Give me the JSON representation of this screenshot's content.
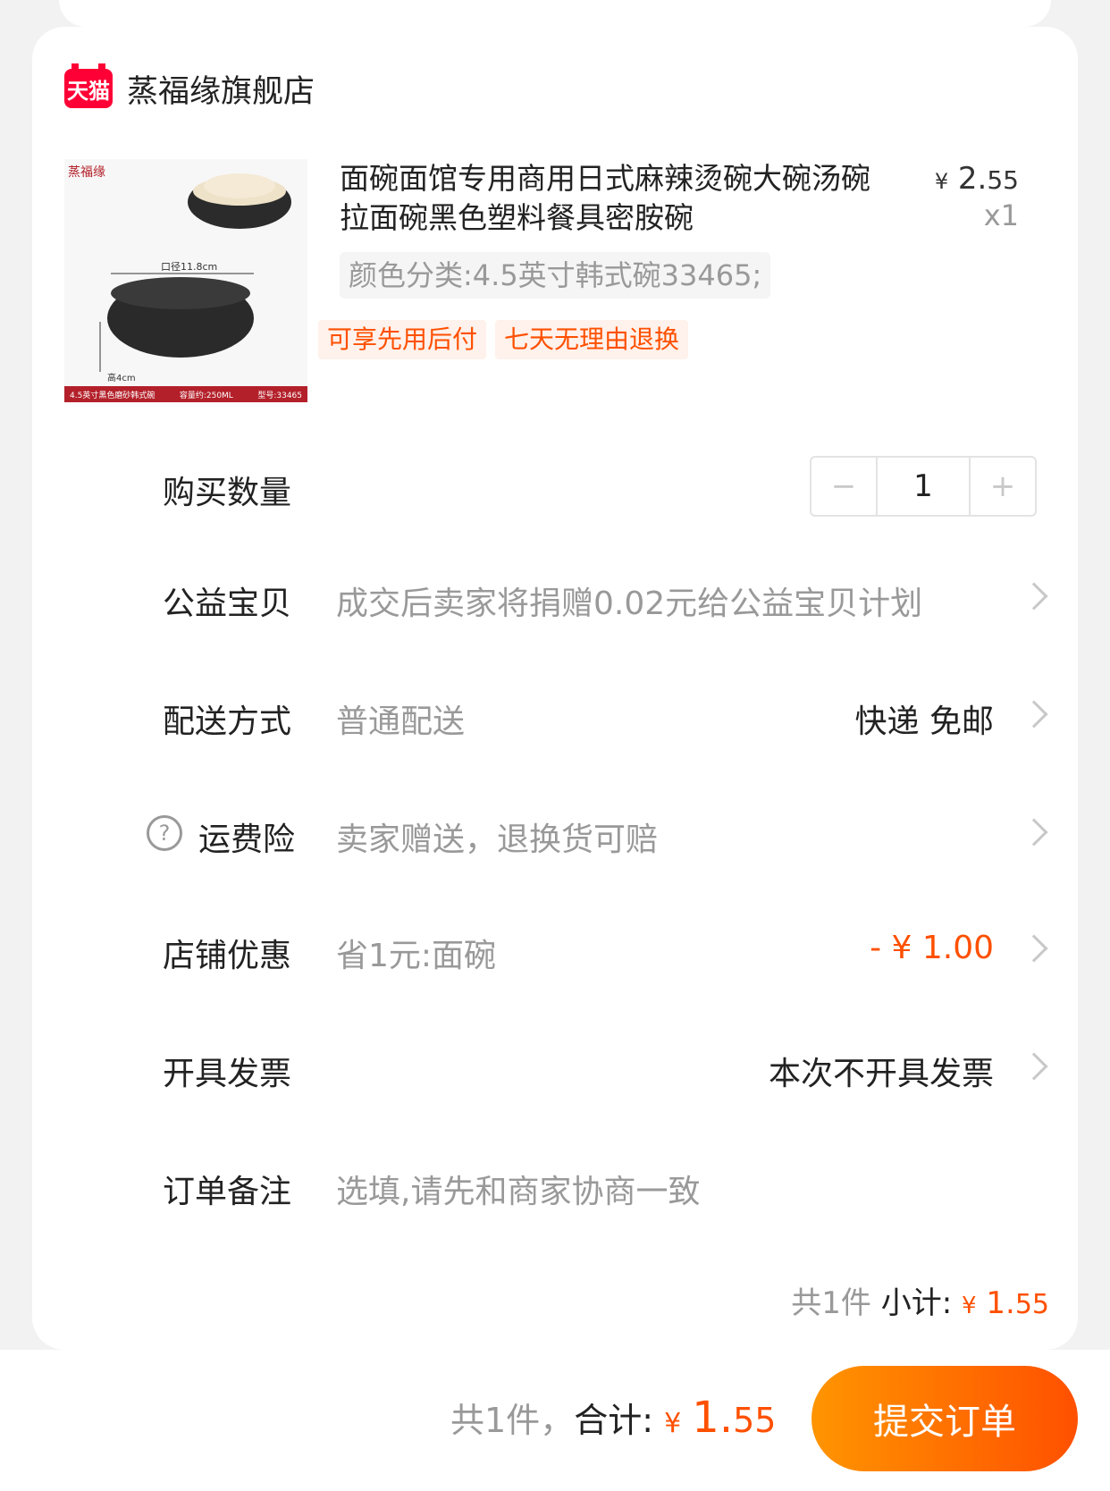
{
  "shop": {
    "logo_text": "天猫",
    "name": "蒸福缘旗舰店"
  },
  "product": {
    "title": "面碗面馆专用商用日式麻辣烫碗大碗汤碗拉面碗黑色塑料餐具密胺碗",
    "price_yen": "¥",
    "price_int": "2.",
    "price_dec": "55",
    "quantity_label": "x1",
    "sku": "颜色分类:4.5英寸韩式碗33465;",
    "tags": [
      "可享先用后付",
      "七天无理由退换"
    ],
    "image": {
      "brand": "蒸福缘",
      "dim_label": "口径11.8cm",
      "height_label": "高4cm",
      "footer": [
        "4.5英寸黑色磨砂韩式碗",
        "容量约:250ML",
        "型号:33465"
      ]
    }
  },
  "quantity": {
    "label": "购买数量",
    "value": "1",
    "minus": "−",
    "plus": "+"
  },
  "charity": {
    "label": "公益宝贝",
    "value": "成交后卖家将捐赠0.02元给公益宝贝计划"
  },
  "delivery": {
    "label": "配送方式",
    "value": "普通配送",
    "right": "快递 免邮"
  },
  "insurance": {
    "label": "运费险",
    "value": "卖家赠送，退换货可赔"
  },
  "discount": {
    "label": "店铺优惠",
    "value": "省1元:面碗",
    "right": "- ¥ 1.00"
  },
  "invoice": {
    "label": "开具发票",
    "right": "本次不开具发票"
  },
  "note": {
    "label": "订单备注",
    "placeholder": "选填,请先和商家协商一致"
  },
  "subtotal": {
    "count": "共1件",
    "label": "小计:",
    "yen": "¥",
    "int": "1.",
    "dec": "55"
  },
  "footer": {
    "count": "共1件，",
    "label": "合计:",
    "yen": "¥",
    "int": "1.",
    "dec": "55",
    "submit": "提交订单"
  },
  "colors": {
    "accent": "#ff5000",
    "button_start": "#ff9500",
    "button_end": "#ff5000"
  }
}
